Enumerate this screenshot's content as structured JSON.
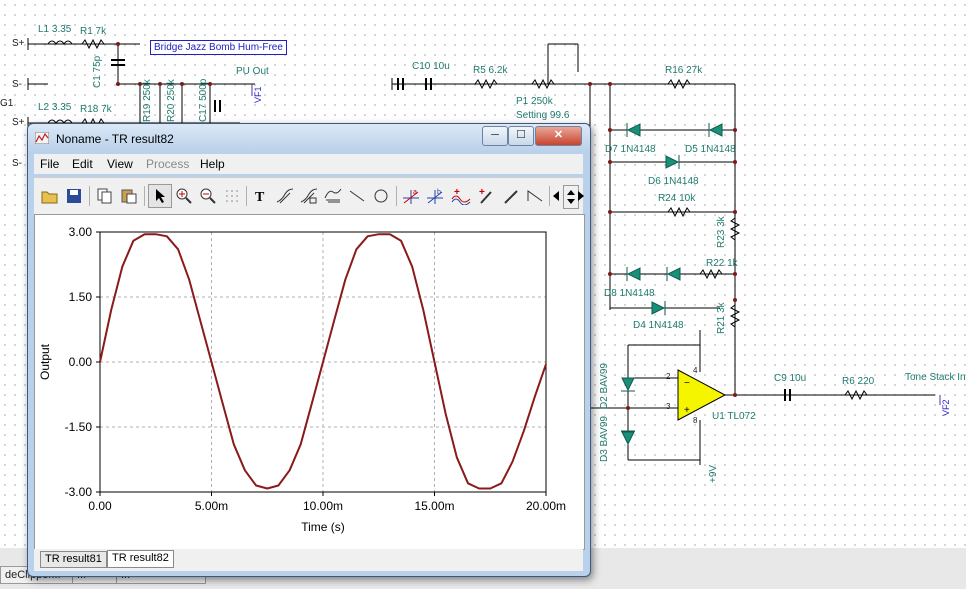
{
  "schematic": {
    "labels": {
      "s_plus_1": "S+",
      "s_minus_1": "S-",
      "s_plus_2": "S+",
      "s_minus_2": "S-",
      "g1": "G1",
      "l1": "L1 3.35",
      "r1": "R1 7k",
      "c1": "C1 75p",
      "l2": "L2 3.35",
      "r18": "R18 7k",
      "r19": "R19 250k",
      "r20": "R20 250k",
      "c17": "C17 500p",
      "pu_out": "PU Out",
      "vf1": "VF1",
      "note": "Bridge Jazz Bomb Hum-Free",
      "c10": "C10 10u",
      "r5": "R5 6.2k",
      "p1": "P1 250k",
      "p1_setting": "Setting 99.6",
      "r16": "R16 27k",
      "d7": "D7 1N4148",
      "d5": "D5 1N4148",
      "d6": "D6 1N4148",
      "r24": "R24 10k",
      "r23": "R23 3k",
      "r22": "R22 1k",
      "d8d1": "D8 1N4148",
      "d4": "D4 1N4148",
      "r21": "R21 3k",
      "d2": "D2 BAV99",
      "d3": "D3 BAV99",
      "u1": "U1 TL072",
      "pin2": "2",
      "pin3": "3",
      "pin8": "8",
      "pin4": "4",
      "plus9v": "+9V",
      "c9": "C9 10u",
      "r6": "R6 220",
      "tone": "Tone Stack In",
      "vf2": "VF2"
    }
  },
  "bottom_tabs": [
    "deClipper...",
    "...",
    "..."
  ],
  "window": {
    "title": "Noname - TR result82",
    "min_label": "─",
    "max_label": "☐",
    "close_label": "✕",
    "menu": {
      "file": "File",
      "edit": "Edit",
      "view": "View",
      "process": "Process",
      "help": "Help"
    },
    "tabs": [
      "TR result81",
      "TR result82"
    ],
    "active_tab": "TR result82"
  },
  "toolbar_icons": [
    "open-icon",
    "save-icon",
    "copy-icon",
    "paste-icon",
    "pointer-icon",
    "zoom-in-icon",
    "zoom-100-icon",
    "grid-icon",
    "text-icon",
    "cursor-a-icon",
    "cursor-b-icon",
    "curve-edit-icon",
    "line-icon",
    "circle-icon",
    "cursor-a-cross-icon",
    "cursor-b-cross-icon",
    "waveform-plus-icon",
    "probe-plus-icon",
    "pen-icon",
    "ramp-icon",
    "scroll-left-icon",
    "scroll-updown-icon",
    "scroll-right-icon"
  ],
  "chart_data": {
    "type": "line",
    "title": "",
    "xlabel": "Time (s)",
    "ylabel": "Output",
    "xlim": [
      0,
      0.02
    ],
    "ylim": [
      -3,
      3
    ],
    "xticks": [
      "0.00",
      "5.00m",
      "10.00m",
      "15.00m",
      "20.00m"
    ],
    "yticks": [
      "3.00",
      "1.50",
      "0.00",
      "-1.50",
      "-3.00"
    ],
    "grid": true,
    "series": [
      {
        "color": "#8b1a1a",
        "x": [
          0,
          0.0005,
          0.001,
          0.0015,
          0.002,
          0.0025,
          0.003,
          0.0035,
          0.004,
          0.0045,
          0.005,
          0.0055,
          0.006,
          0.0065,
          0.007,
          0.0075,
          0.008,
          0.0085,
          0.009,
          0.0095,
          0.01,
          0.0105,
          0.011,
          0.0115,
          0.012,
          0.0125,
          0.013,
          0.0135,
          0.014,
          0.0145,
          0.015,
          0.0155,
          0.016,
          0.0165,
          0.017,
          0.0175,
          0.018,
          0.0185,
          0.019,
          0.0195,
          0.02
        ],
        "y": [
          0,
          1.2,
          2.2,
          2.8,
          2.95,
          2.95,
          2.9,
          2.6,
          1.9,
          0.95,
          0,
          -0.95,
          -1.9,
          -2.5,
          -2.85,
          -2.92,
          -2.85,
          -2.5,
          -1.9,
          -0.95,
          0,
          0.95,
          1.9,
          2.6,
          2.9,
          2.95,
          2.95,
          2.8,
          2.2,
          1.2,
          0,
          -1.2,
          -2.2,
          -2.8,
          -2.92,
          -2.92,
          -2.8,
          -2.3,
          -1.6,
          -0.8,
          -0.05
        ]
      }
    ]
  }
}
